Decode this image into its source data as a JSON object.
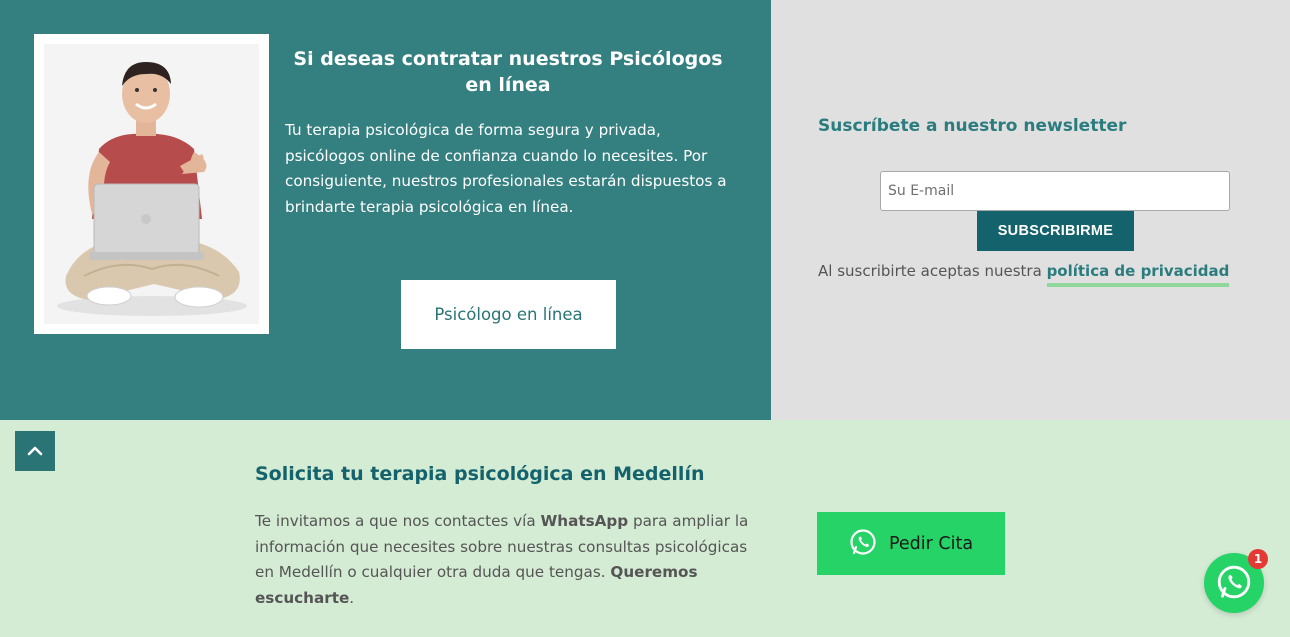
{
  "promo": {
    "title": "Si deseas contratar nuestros Psicólogos en línea",
    "text": "Tu terapia psicológica de forma segura y privada, psicólogos online de confianza cuando lo necesites. Por consiguiente, nuestros profesionales estarán dispuestos a brindarte terapia psicológica en línea.",
    "button_label": "Psicólogo en línea",
    "image_icon": "person-with-laptop-photo"
  },
  "newsletter": {
    "title": "Suscríbete a nuestro newsletter",
    "email_placeholder": "Su E-mail",
    "button_label": "SUBSCRIBIRME",
    "consent_prefix": "Al suscribirte aceptas nuestra ",
    "privacy_link": "política de privacidad"
  },
  "cta": {
    "title": "Solicita tu terapia psicológica en Medellín",
    "text_1": "Te invitamos a que nos contactes vía ",
    "text_bold_1": "WhatsApp",
    "text_2": " para ampliar la información que necesites sobre nuestras consultas psicológicas en Medellín o cualquier otra duda que tengas. ",
    "text_bold_2": "Queremos escucharte",
    "text_3": ".",
    "whatsapp_button_label": "Pedir Cita"
  },
  "floating": {
    "badge_count": "1"
  },
  "colors": {
    "teal_panel": "#347f80",
    "grey_panel": "#e0e0e0",
    "green_section": "#d4ebd4",
    "dark_teal": "#13626c",
    "whatsapp_green": "#25d366",
    "link_underline": "#8fd79b",
    "badge_red": "#e53935"
  },
  "icons": [
    "chevron-up-icon",
    "whatsapp-icon"
  ]
}
